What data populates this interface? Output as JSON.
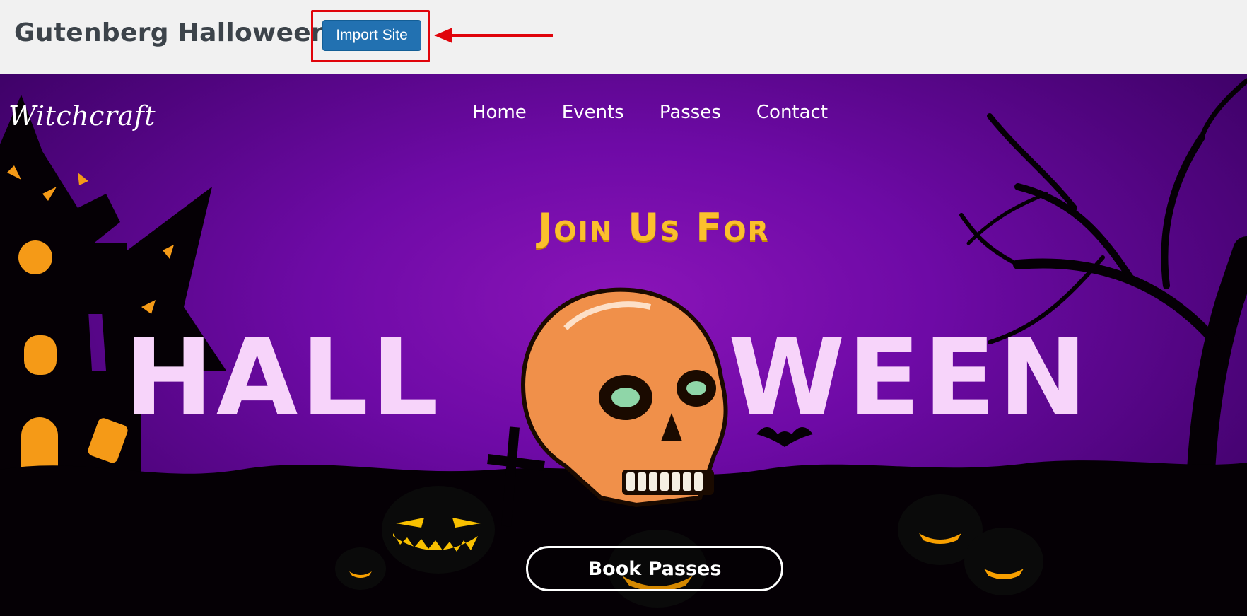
{
  "admin_bar": {
    "site_title": "Gutenberg Halloween",
    "import_button": "Import Site"
  },
  "hero": {
    "logo": "Witchcraft",
    "nav": [
      "Home",
      "Events",
      "Passes",
      "Contact"
    ],
    "tagline": "Join Us For",
    "headline_left": "HALL",
    "headline_right": "WEEN",
    "cta": "Book Passes"
  },
  "colors": {
    "admin_button": "#2271b1",
    "highlight": "#e0040b",
    "hero_purple": "#7a10ae",
    "tagline_yellow": "#fbc02d",
    "headline_pink": "#f7d4fa",
    "skull_orange": "#f0904a",
    "eye_green": "#8fd6a8"
  },
  "icons": [
    "arrow-left-icon",
    "skull-icon",
    "pumpkin-icon",
    "bat-icon",
    "tree-icon",
    "haunted-house-icon"
  ]
}
